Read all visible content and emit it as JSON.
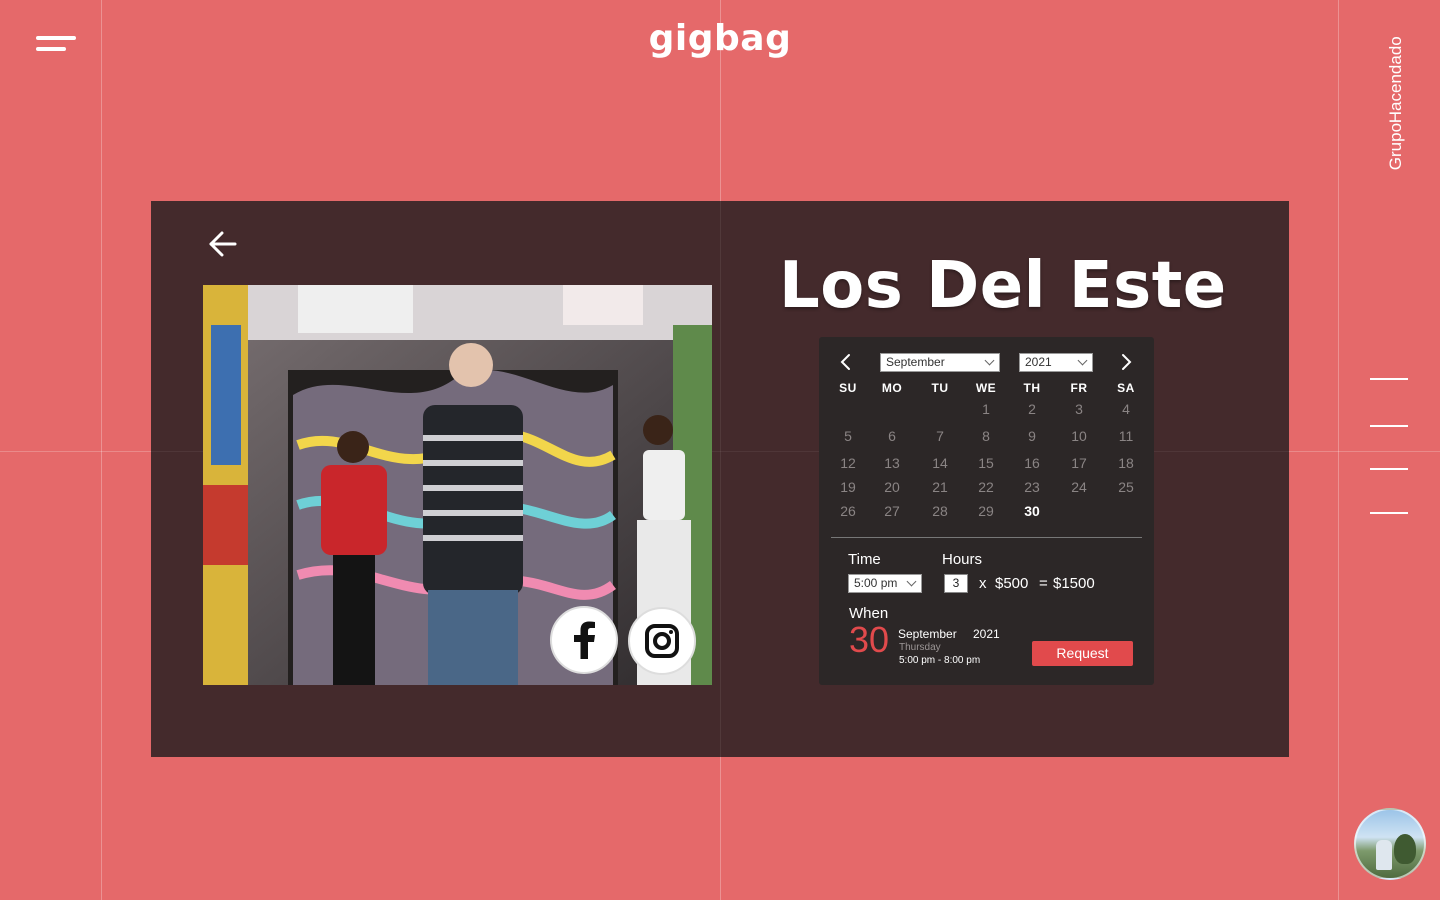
{
  "app": {
    "logo": "gigbag"
  },
  "sidebar_right": {
    "label_line1": "Grupo",
    "label_line2": "Hacendado"
  },
  "band": {
    "name": "Los Del Este"
  },
  "calendar": {
    "month": "September",
    "year": "2021",
    "weekdays": [
      "SU",
      "MO",
      "TU",
      "WE",
      "TH",
      "FR",
      "SA"
    ],
    "days": [
      "1",
      "2",
      "3",
      "4",
      "5",
      "6",
      "7",
      "8",
      "9",
      "10",
      "11",
      "12",
      "13",
      "14",
      "15",
      "16",
      "17",
      "18",
      "19",
      "20",
      "21",
      "22",
      "23",
      "24",
      "25",
      "26",
      "27",
      "28",
      "29",
      "30"
    ],
    "selected_day": "30"
  },
  "booking": {
    "time_label": "Time",
    "time_value": "5:00 pm",
    "hours_label": "Hours",
    "hours_value": "3",
    "multiply": "x",
    "rate": "$500",
    "equals": "=",
    "total": "$1500",
    "when_label": "When",
    "when_day": "30",
    "when_month": "September",
    "when_year": "2021",
    "when_weekday": "Thursday",
    "when_range": "5:00 pm - 8:00 pm",
    "request_label": "Request"
  },
  "colors": {
    "background": "#e5696a",
    "card": "#442a2c",
    "panel": "#2c2727",
    "accent": "#e14a4c"
  },
  "icons": [
    "menu-icon",
    "back-arrow-icon",
    "facebook-icon",
    "instagram-icon",
    "chevron-left-icon",
    "chevron-right-icon"
  ]
}
